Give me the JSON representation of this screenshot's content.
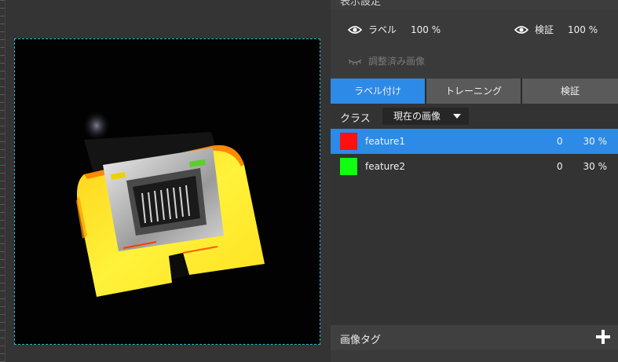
{
  "panel": {
    "header_title": "表示設定",
    "visibility": {
      "label_text": "ラベル",
      "label_value": "100 %",
      "verify_text": "検証",
      "verify_value": "100 %",
      "adjusted_image_text": "調整済み画像"
    },
    "tabs": [
      {
        "label": "ラベル付け",
        "active": true
      },
      {
        "label": "トレーニング",
        "active": false
      },
      {
        "label": "検証",
        "active": false
      }
    ],
    "class_label": "クラス",
    "class_dropdown_value": "現在の画像",
    "features": [
      {
        "name": "feature1",
        "count": "0",
        "percent": "30 %",
        "color": "#ff1010",
        "selected": true
      },
      {
        "name": "feature2",
        "count": "0",
        "percent": "30 %",
        "color": "#10ff10",
        "selected": false
      }
    ],
    "image_tag_label": "画像タグ"
  },
  "colors": {
    "accent": "#2d8ae6",
    "frame_border": "#2fb7c7"
  }
}
